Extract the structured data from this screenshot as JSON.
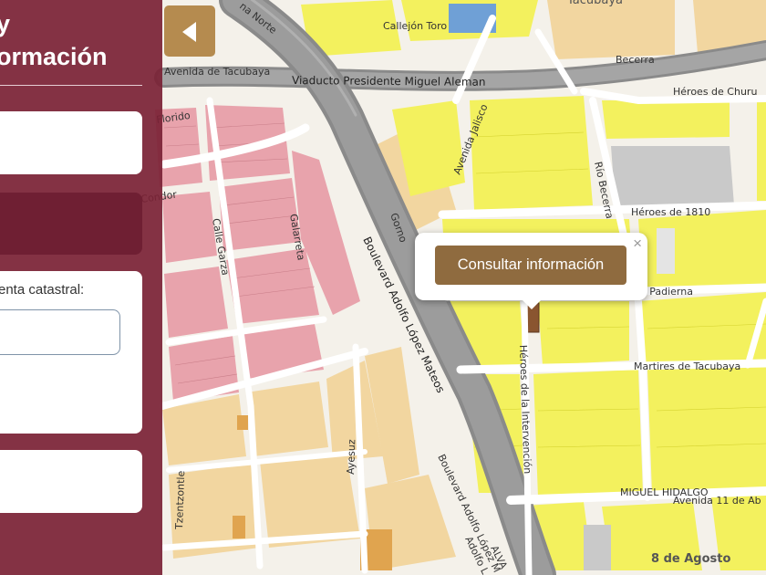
{
  "sidebar": {
    "title": "y\normación",
    "cuenta_label": "enta catastral:",
    "cuenta_value": ""
  },
  "map": {
    "neighborhood_labels": [
      "Tacubaya",
      "8 de Agosto"
    ],
    "streets": {
      "viaducto": "Viaducto Presidente Miguel Aleman",
      "adolfo_lopez_mateos": "Boulevard Adolfo López Mateos",
      "adolfo_lopez_mateos_2": "Boulevard Adolfo López M",
      "heroes_1810": "Héroes de 1810",
      "heroes_churubusco": "Héroes de Churu",
      "martires": "Martires de Tacubaya",
      "padierna": "s Padierna",
      "avenida_11": "Avenida 11 de Ab",
      "becerra": "Becerra",
      "rio_becerra": "Río Becerra",
      "jalisco": "Avenida Jalisco",
      "calle_garza": "Calle Garza",
      "galarreta": "Galarreta",
      "avenida_tacubaya": "Avenida de Tacubaya",
      "calle_toro": "Callejón Toro",
      "florido": "Florido",
      "condor": "Condor",
      "gomez": "Gorno",
      "heroes_intervencion": "Héroes de la Intervención",
      "tzentzontle": "Tzentzontle",
      "ayesuz": "Ayesuz",
      "miguel_hidalgo": "MIGUEL HIDALGO",
      "norte": "na Norte",
      "alva": "ALVA",
      "adolfo_lopez_4": "Adolfo L"
    },
    "colors": {
      "residential_yellow": "#f3f15e",
      "mixed_tan": "#f2d6a0",
      "pink": "#e8a3ac",
      "gray": "#c9c9c9",
      "blue": "#6fa0d6",
      "selected": "#8a5530"
    }
  },
  "collapse_button": {
    "icon": "triangle-left-icon"
  },
  "popup": {
    "close_label": "×",
    "action_label": "Consultar información"
  }
}
